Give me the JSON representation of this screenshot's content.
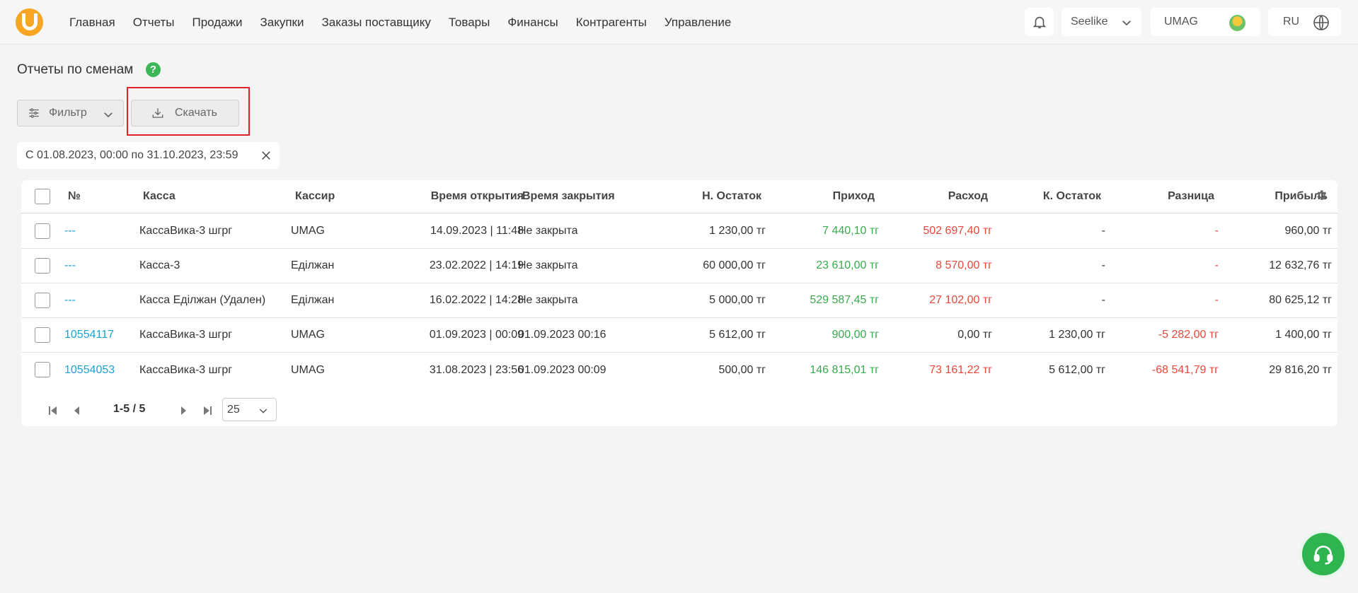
{
  "nav": {
    "items": [
      "Главная",
      "Отчеты",
      "Продажи",
      "Закупки",
      "Заказы поставщику",
      "Товары",
      "Финансы",
      "Контрагенты",
      "Управление"
    ]
  },
  "header": {
    "store": "Seelike",
    "account": "UMAG",
    "lang": "RU"
  },
  "page": {
    "title": "Отчеты по сменам",
    "filter_label": "Фильтр",
    "download_label": "Скачать",
    "date_chip": "С 01.08.2023, 00:00 по 31.10.2023, 23:59"
  },
  "table": {
    "headers": {
      "num": "№",
      "kassa": "Касса",
      "cashier": "Кассир",
      "open": "Время открытия",
      "close": "Время закрытия",
      "start_bal": "Н. Остаток",
      "income": "Приход",
      "expense": "Расход",
      "end_bal": "К. Остаток",
      "diff": "Разница",
      "profit": "Прибыль"
    },
    "rows": [
      {
        "num": "---",
        "kassa": "КассаВика-3 шгрг",
        "cashier": "UMAG",
        "open": "14.09.2023 | 11:48",
        "close": "Не закрыта",
        "start_bal": "1 230,00 тг",
        "income": "7 440,10 тг",
        "expense": "502 697,40 тг",
        "end_bal": "-",
        "diff": "-",
        "profit": "960,00 тг"
      },
      {
        "num": "---",
        "kassa": "Касса-3",
        "cashier": "Еділжан",
        "open": "23.02.2022 | 14:19",
        "close": "Не закрыта",
        "start_bal": "60 000,00 тг",
        "income": "23 610,00 тг",
        "expense": "8 570,00 тг",
        "end_bal": "-",
        "diff": "-",
        "profit": "12 632,76 тг"
      },
      {
        "num": "---",
        "kassa": "Касса Еділжан (Удален)",
        "cashier": "Еділжан",
        "open": "16.02.2022 | 14:28",
        "close": "Не закрыта",
        "start_bal": "5 000,00 тг",
        "income": "529 587,45 тг",
        "expense": "27 102,00 тг",
        "end_bal": "-",
        "diff": "-",
        "profit": "80 625,12 тг"
      },
      {
        "num": "10554117",
        "kassa": "КассаВика-3 шгрг",
        "cashier": "UMAG",
        "open": "01.09.2023 | 00:09",
        "close": "01.09.2023 00:16",
        "start_bal": "5 612,00 тг",
        "income": "900,00 тг",
        "expense": "0,00 тг",
        "end_bal": "1 230,00 тг",
        "diff": "-5 282,00 тг",
        "profit": "1 400,00 тг"
      },
      {
        "num": "10554053",
        "kassa": "КассаВика-3 шгрг",
        "cashier": "UMAG",
        "open": "31.08.2023 | 23:56",
        "close": "01.09.2023 00:09",
        "start_bal": "500,00 тг",
        "income": "146 815,01 тг",
        "expense": "73 161,22 тг",
        "end_bal": "5 612,00 тг",
        "diff": "-68 541,79 тг",
        "profit": "29 816,20 тг"
      }
    ]
  },
  "pagination": {
    "range": "1-5 / 5",
    "page_size": "25"
  },
  "colors": {
    "accent": "#f6a623",
    "income": "#3aaa4f",
    "expense": "#e8483b",
    "link": "#1aa3d9",
    "highlight": "#e01f26"
  }
}
